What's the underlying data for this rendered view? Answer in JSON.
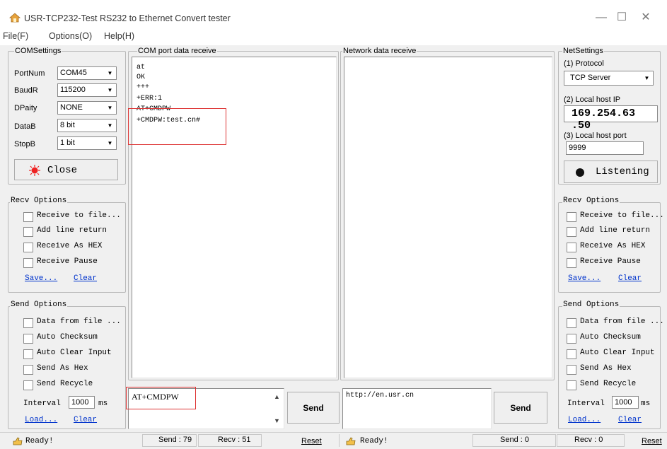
{
  "window": {
    "title": "USR-TCP232-Test  RS232 to Ethernet Convert tester",
    "minimize": "—",
    "maximize": "☐",
    "close": "✕"
  },
  "menu": [
    "File(F)",
    "Options(O)",
    "Help(H)"
  ],
  "com_settings": {
    "group_label": "COMSettings",
    "rows": [
      {
        "label": "PortNum",
        "value": "COM45"
      },
      {
        "label": "BaudR",
        "value": "115200"
      },
      {
        "label": "DPaity",
        "value": "NONE"
      },
      {
        "label": "DataB",
        "value": "8 bit"
      },
      {
        "label": "StopB",
        "value": "1 bit"
      }
    ],
    "close_button": "Close"
  },
  "left_recv_options": {
    "group_label": "Recv Options",
    "items": [
      "Receive to file...",
      "Add line return",
      "Receive As HEX",
      "Receive Pause"
    ],
    "save_link": "Save...",
    "clear_link": "Clear"
  },
  "left_send_options": {
    "group_label": "Send Options",
    "items": [
      "Data from file ...",
      "Auto Checksum",
      "Auto Clear Input",
      "Send As Hex",
      "Send Recycle"
    ],
    "interval_label": "Interval",
    "interval_value": "1000",
    "interval_unit": "ms",
    "load_link": "Load...",
    "clear_link": "Clear"
  },
  "com_receive": {
    "group_label": "COM port data receive",
    "lines": [
      "at",
      "OK",
      "+++",
      "+ERR:1",
      "AT+CMDPW",
      "+CMDPW:test.cn#"
    ]
  },
  "com_send": {
    "input_value": "AT+CMDPW",
    "send_button": "Send"
  },
  "net_receive": {
    "group_label": "Network data receive"
  },
  "net_send": {
    "input_value": "http://en.usr.cn",
    "send_button": "Send"
  },
  "net_settings": {
    "group_label": "NetSettings",
    "protocol_label": "(1) Protocol",
    "protocol_value": "TCP Server",
    "ip_label": "(2) Local host IP",
    "ip_value": "169.254.63 .50",
    "port_label": "(3) Local host port",
    "port_value": "9999",
    "listen_button": "Listening"
  },
  "right_recv_options": {
    "group_label": "Recv Options",
    "items": [
      "Receive to file...",
      "Add line return",
      "Receive As HEX",
      "Receive Pause"
    ],
    "save_link": "Save...",
    "clear_link": "Clear"
  },
  "right_send_options": {
    "group_label": "Send Options",
    "items": [
      "Data from file ...",
      "Auto Checksum",
      "Auto Clear Input",
      "Send As Hex",
      "Send Recycle"
    ],
    "interval_label": "Interval",
    "interval_value": "1000",
    "interval_unit": "ms",
    "load_link": "Load...",
    "clear_link": "Clear"
  },
  "status_bar": {
    "left_ready": "Ready!",
    "send_count": "Send : 79",
    "recv_count": "Recv : 51",
    "reset_left": "Reset",
    "right_ready": "Ready!",
    "net_send_count": "Send : 0",
    "net_recv_count": "Recv : 0",
    "reset_right": "Reset"
  },
  "colors": {
    "window_bg": "#f0f0f0",
    "highlight_box": "#dd3333",
    "link": "#0033cc",
    "indicator_red": "#ee2222"
  }
}
